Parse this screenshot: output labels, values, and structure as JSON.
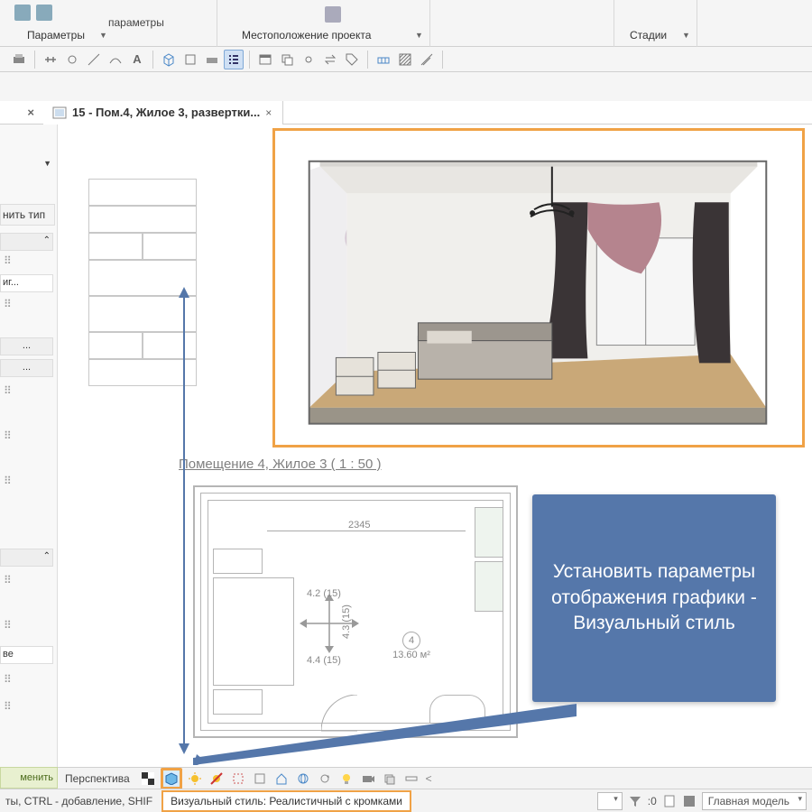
{
  "ribbon": {
    "label_params": "параметры",
    "panel_params": "Параметры",
    "panel_location": "Местоположение проекта",
    "panel_stages": "Стадии"
  },
  "tab": {
    "title": "15 - Пом.4, Жилое 3, развертки...",
    "close": "×"
  },
  "leftpanel": {
    "edit_type": "нить тип",
    "row_ig": "иг...",
    "row_dots1": "...",
    "row_dots2": "...",
    "row_ve": "ве",
    "apply": "менить"
  },
  "caption": "Помещение 4, Жилое 3 ( 1 : 50 )",
  "plan": {
    "dim_top": "2345",
    "dim_h": "4.2 (15)",
    "dim_v": "4.3 (15)",
    "dim_b": "4.4 (15)",
    "room_no": "4",
    "area": "13.60 м²"
  },
  "callout": "Установить параметры отображения графики - Визуальный стиль",
  "viewbar": {
    "label": "Перспектива"
  },
  "status": {
    "hint": "ты, CTRL - добавление, SHIF",
    "style": "Визуальный стиль: Реалистичный с кромками",
    "zero": ":0",
    "model": "Главная модель"
  }
}
